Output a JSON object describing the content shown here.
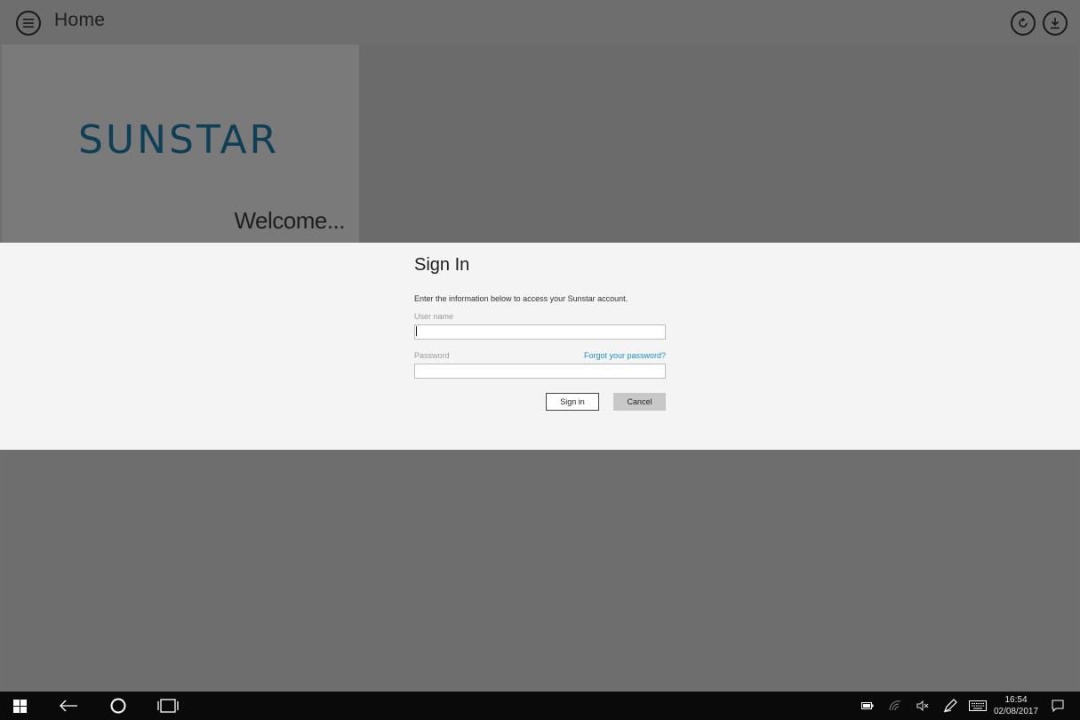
{
  "header": {
    "title": "Home",
    "menu_icon": "hamburger-icon",
    "refresh_icon": "refresh-icon",
    "download_icon": "download-icon"
  },
  "banner": {
    "logo_text": "SUNSTAR",
    "welcome_text": "Welcome..."
  },
  "signin_dialog": {
    "title": "Sign In",
    "description": "Enter the information below to access your Sunstar account.",
    "username_label": "User name",
    "username_value": "",
    "password_label": "Password",
    "password_value": "",
    "forgot_link": "Forgot your password?",
    "signin_button": "Sign in",
    "cancel_button": "Cancel"
  },
  "taskbar": {
    "time": "16:54",
    "date": "02/08/2017"
  },
  "colors": {
    "logo": "#0f3f55",
    "link": "#1a8fc7",
    "dialog_bg": "#f4f4f4",
    "overlay": "#6f6f6f",
    "taskbar": "#0a0a0a"
  }
}
